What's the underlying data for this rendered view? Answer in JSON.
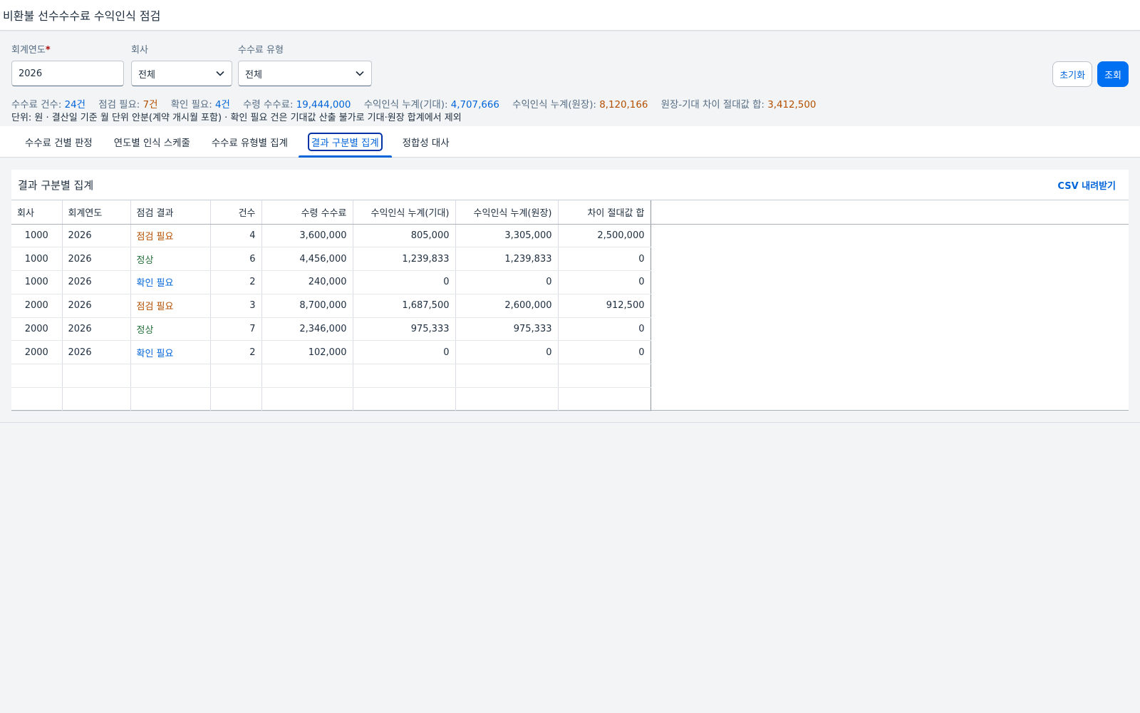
{
  "page": {
    "title": "비환불 선수수수료 수익인식 점검"
  },
  "filters": {
    "fiscal_year": {
      "label": "회계연도",
      "required_mark": "*",
      "value": "2026"
    },
    "company": {
      "label": "회사",
      "value": "전체"
    },
    "fee_type": {
      "label": "수수료 유형",
      "value": "전체"
    }
  },
  "actions": {
    "reset_label": "초기화",
    "search_label": "조회"
  },
  "summary": {
    "fee_count_label": "수수료 건수:",
    "fee_count_value": "24건",
    "check_needed_label": "점검 필요:",
    "check_needed_value": "7건",
    "confirm_needed_label": "확인 필요:",
    "confirm_needed_value": "4건",
    "received_label": "수령 수수료:",
    "received_value": "19,444,000",
    "cum_expected_label": "수익인식 누계(기대):",
    "cum_expected_value": "4,707,666",
    "cum_ledger_label": "수익인식 누계(원장):",
    "cum_ledger_value": "8,120,166",
    "diff_label": "원장-기대 차이 절대값 합:",
    "diff_value": "3,412,500",
    "note": "단위: 원 · 결산일 기준 월 단위 안분(계약 개시월 포함) · 확인 필요 건은 기대값 산출 불가로 기대·원장 합계에서 제외"
  },
  "tabs": [
    {
      "label": "수수료 건별 판정",
      "active": false
    },
    {
      "label": "연도별 인식 스케줄",
      "active": false
    },
    {
      "label": "수수료 유형별 집계",
      "active": false
    },
    {
      "label": "결과 구분별 집계",
      "active": true
    },
    {
      "label": "정합성 대사",
      "active": false
    }
  ],
  "panel": {
    "title": "결과 구분별 집계",
    "csv_label": "CSV 내려받기"
  },
  "table": {
    "headers": [
      "회사",
      "회계연도",
      "점검 결과",
      "건수",
      "수령 수수료",
      "수익인식 누계(기대)",
      "수익인식 누계(원장)",
      "차이 절대값 합"
    ],
    "rows": [
      [
        "1000",
        "2026",
        "점검 필요",
        "4",
        "3,600,000",
        "805,000",
        "3,305,000",
        "2,500,000"
      ],
      [
        "1000",
        "2026",
        "정상",
        "6",
        "4,456,000",
        "1,239,833",
        "1,239,833",
        "0"
      ],
      [
        "1000",
        "2026",
        "확인 필요",
        "2",
        "240,000",
        "0",
        "0",
        "0"
      ],
      [
        "2000",
        "2026",
        "점검 필요",
        "3",
        "8,700,000",
        "1,687,500",
        "2,600,000",
        "912,500"
      ],
      [
        "2000",
        "2026",
        "정상",
        "7",
        "2,346,000",
        "975,333",
        "975,333",
        "0"
      ],
      [
        "2000",
        "2026",
        "확인 필요",
        "2",
        "102,000",
        "0",
        "0",
        "0"
      ],
      [
        "",
        "",
        "",
        "",
        "",
        "",
        "",
        ""
      ],
      [
        "",
        "",
        "",
        "",
        "",
        "",
        "",
        ""
      ]
    ]
  },
  "colors": {
    "accent": "#0070f2",
    "status_check_needed": "#b44f00",
    "status_normal": "#256f3a",
    "status_confirm_needed": "#0064d9"
  }
}
